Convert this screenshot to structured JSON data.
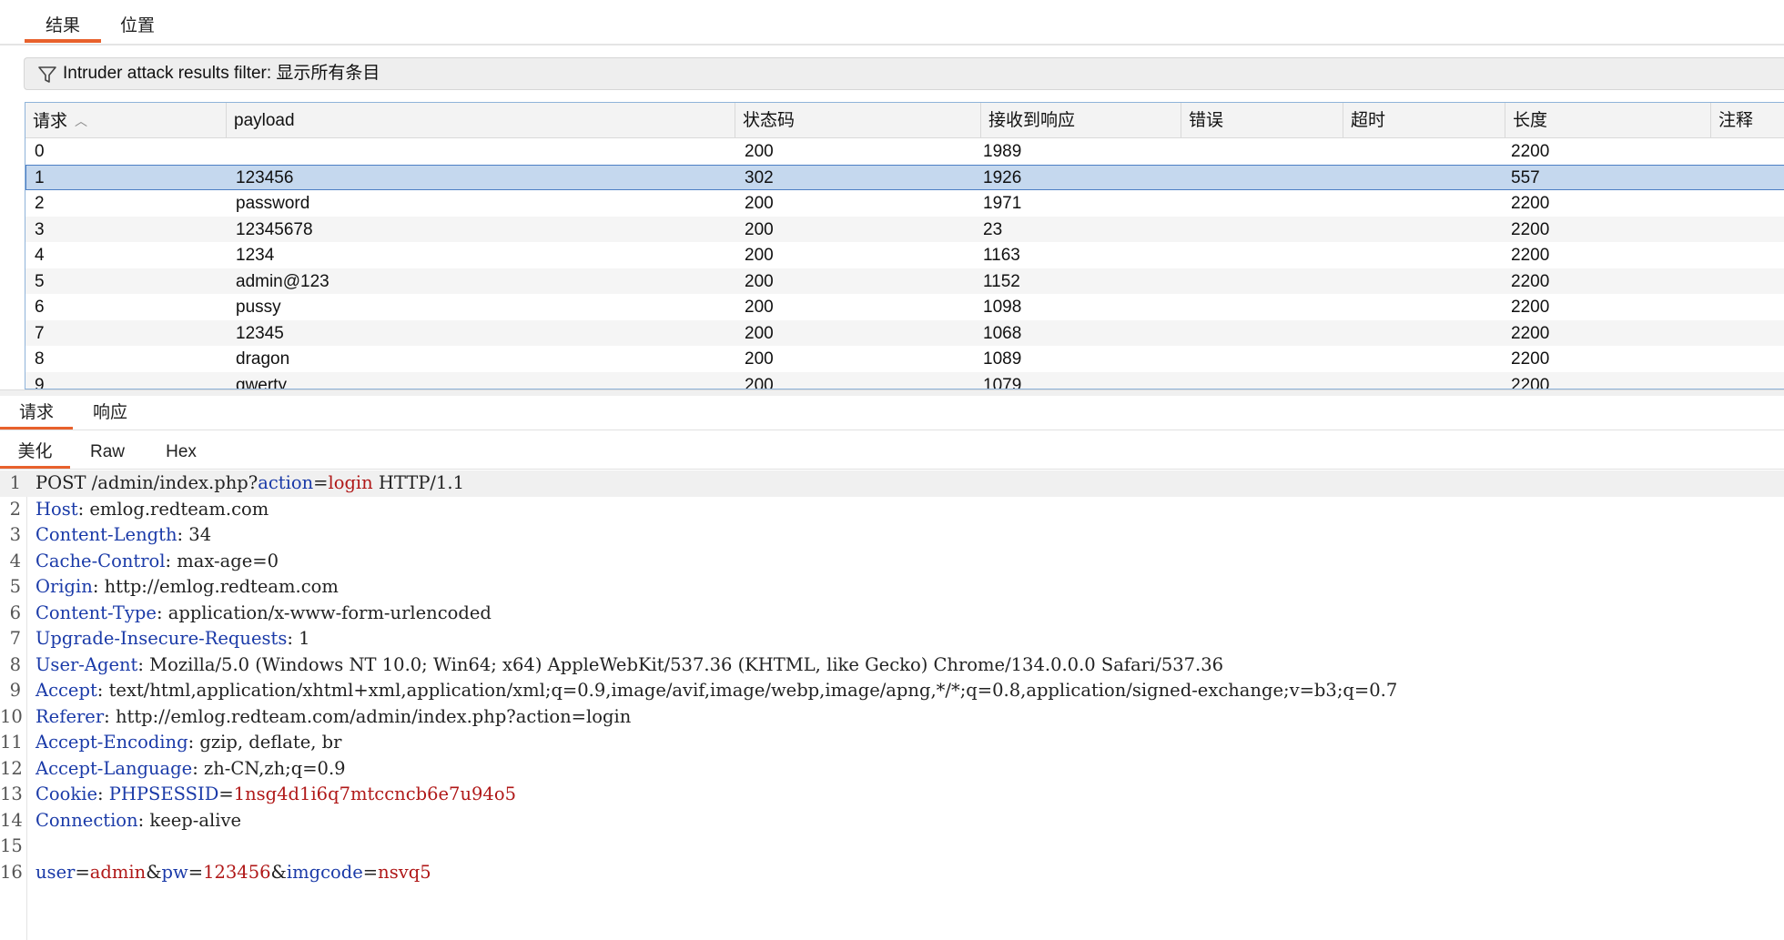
{
  "top_tabs": [
    {
      "label": "结果",
      "active": true
    },
    {
      "label": "位置",
      "active": false
    }
  ],
  "filter": {
    "icon": "filter-icon",
    "text": "Intruder attack results filter: 显示所有条目"
  },
  "table": {
    "columns": [
      "请求",
      "payload",
      "状态码",
      "接收到响应",
      "错误",
      "超时",
      "长度",
      "注释"
    ],
    "sort_column": "请求",
    "selected_row": 1,
    "rows": [
      {
        "req": "0",
        "payload": "",
        "status": "200",
        "resp": "1989",
        "length": "2200"
      },
      {
        "req": "1",
        "payload": "123456",
        "status": "302",
        "resp": "1926",
        "length": "557"
      },
      {
        "req": "2",
        "payload": "password",
        "status": "200",
        "resp": "1971",
        "length": "2200"
      },
      {
        "req": "3",
        "payload": "12345678",
        "status": "200",
        "resp": "23",
        "length": "2200"
      },
      {
        "req": "4",
        "payload": "1234",
        "status": "200",
        "resp": "1163",
        "length": "2200"
      },
      {
        "req": "5",
        "payload": "admin@123",
        "status": "200",
        "resp": "1152",
        "length": "2200"
      },
      {
        "req": "6",
        "payload": "pussy",
        "status": "200",
        "resp": "1098",
        "length": "2200"
      },
      {
        "req": "7",
        "payload": "12345",
        "status": "200",
        "resp": "1068",
        "length": "2200"
      },
      {
        "req": "8",
        "payload": "dragon",
        "status": "200",
        "resp": "1089",
        "length": "2200"
      },
      {
        "req": "9",
        "payload": "qwerty",
        "status": "200",
        "resp": "1079",
        "length": "2200"
      }
    ]
  },
  "detail_tabs": [
    {
      "label": "请求",
      "active": true
    },
    {
      "label": "响应",
      "active": false
    }
  ],
  "view_tabs": [
    {
      "label": "美化",
      "active": true
    },
    {
      "label": "Raw",
      "active": false
    },
    {
      "label": "Hex",
      "active": false
    }
  ],
  "request_lines": [
    [
      {
        "t": "POST /admin/index.php?",
        "c": ""
      },
      {
        "t": "action",
        "c": "k"
      },
      {
        "t": "=",
        "c": ""
      },
      {
        "t": "login",
        "c": "v"
      },
      {
        "t": " HTTP/1.1",
        "c": ""
      }
    ],
    [
      {
        "t": "Host",
        "c": "k"
      },
      {
        "t": ": emlog.redteam.com",
        "c": ""
      }
    ],
    [
      {
        "t": "Content-Length",
        "c": "k"
      },
      {
        "t": ": 34",
        "c": ""
      }
    ],
    [
      {
        "t": "Cache-Control",
        "c": "k"
      },
      {
        "t": ": max-age=0",
        "c": ""
      }
    ],
    [
      {
        "t": "Origin",
        "c": "k"
      },
      {
        "t": ": http://emlog.redteam.com",
        "c": ""
      }
    ],
    [
      {
        "t": "Content-Type",
        "c": "k"
      },
      {
        "t": ": application/x-www-form-urlencoded",
        "c": ""
      }
    ],
    [
      {
        "t": "Upgrade-Insecure-Requests",
        "c": "k"
      },
      {
        "t": ": 1",
        "c": ""
      }
    ],
    [
      {
        "t": "User-Agent",
        "c": "k"
      },
      {
        "t": ": Mozilla/5.0 (Windows NT 10.0; Win64; x64) AppleWebKit/537.36 (KHTML, like Gecko) Chrome/134.0.0.0 Safari/537.36",
        "c": ""
      }
    ],
    [
      {
        "t": "Accept",
        "c": "k"
      },
      {
        "t": ": text/html,application/xhtml+xml,application/xml;q=0.9,image/avif,image/webp,image/apng,*/*;q=0.8,application/signed-exchange;v=b3;q=0.7",
        "c": ""
      }
    ],
    [
      {
        "t": "Referer",
        "c": "k"
      },
      {
        "t": ": http://emlog.redteam.com/admin/index.php?action=login",
        "c": ""
      }
    ],
    [
      {
        "t": "Accept-Encoding",
        "c": "k"
      },
      {
        "t": ": gzip, deflate, br",
        "c": ""
      }
    ],
    [
      {
        "t": "Accept-Language",
        "c": "k"
      },
      {
        "t": ": zh-CN,zh;q=0.9",
        "c": ""
      }
    ],
    [
      {
        "t": "Cookie",
        "c": "k"
      },
      {
        "t": ": ",
        "c": ""
      },
      {
        "t": "PHPSESSID",
        "c": "k"
      },
      {
        "t": "=",
        "c": ""
      },
      {
        "t": "1nsg4d1i6q7mtccncb6e7u94o5",
        "c": "v"
      }
    ],
    [
      {
        "t": "Connection",
        "c": "k"
      },
      {
        "t": ": keep-alive",
        "c": ""
      }
    ],
    [],
    [
      {
        "t": "user",
        "c": "k"
      },
      {
        "t": "=",
        "c": ""
      },
      {
        "t": "admin",
        "c": "v"
      },
      {
        "t": "&",
        "c": ""
      },
      {
        "t": "pw",
        "c": "k"
      },
      {
        "t": "=",
        "c": ""
      },
      {
        "t": "123456",
        "c": "v"
      },
      {
        "t": "&",
        "c": ""
      },
      {
        "t": "imgcode",
        "c": "k"
      },
      {
        "t": "=",
        "c": ""
      },
      {
        "t": "nsvq5",
        "c": "v"
      }
    ]
  ]
}
